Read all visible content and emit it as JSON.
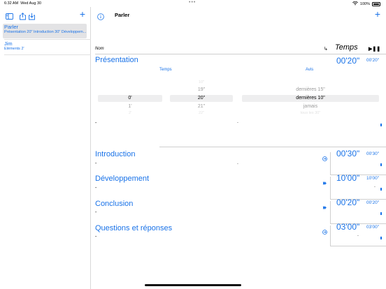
{
  "status": {
    "time": "6:32 AM",
    "date": "Wed Aug 30",
    "battery": "100%"
  },
  "sidebar": {
    "add": "+",
    "items": [
      {
        "title": "Parler",
        "subtitle": "Présentation 20\" Introduction 30\" Développem..."
      },
      {
        "title": "Jim",
        "subtitle": "Éléments 2'"
      }
    ]
  },
  "main": {
    "title": "Parler",
    "add": "+",
    "columns": {
      "nom": "Nom",
      "arrow": "↳",
      "temps": "Temps",
      "play": "▶❚❚"
    },
    "picker": {
      "label_temps": "Temps",
      "label_avis": "Avis",
      "minutes": [
        "0'",
        "1'",
        "2'"
      ],
      "seconds": [
        "10\"",
        "19\"",
        "20\"",
        "21\"",
        "22\""
      ],
      "avis": [
        "dernières 15\"",
        "dernières 10\"",
        "jamais",
        "tous les 30\""
      ]
    },
    "sections": [
      {
        "name": "Présentation",
        "dur": "00'20\"",
        "dur_small": "00'20\""
      },
      {
        "name": "Introduction",
        "dur": "00'30\"",
        "dur_small": "00'30\""
      },
      {
        "name": "Développement",
        "dur": "10'00\"",
        "dur_small": "10'00\""
      },
      {
        "name": "Conclusion",
        "dur": "00'20\"",
        "dur_small": "00'20\""
      },
      {
        "name": "Questions et réponses",
        "dur": "03'00\"",
        "dur_small": "03'00\""
      }
    ],
    "dash": "-",
    "dot": ".",
    "small_dash": "'"
  }
}
